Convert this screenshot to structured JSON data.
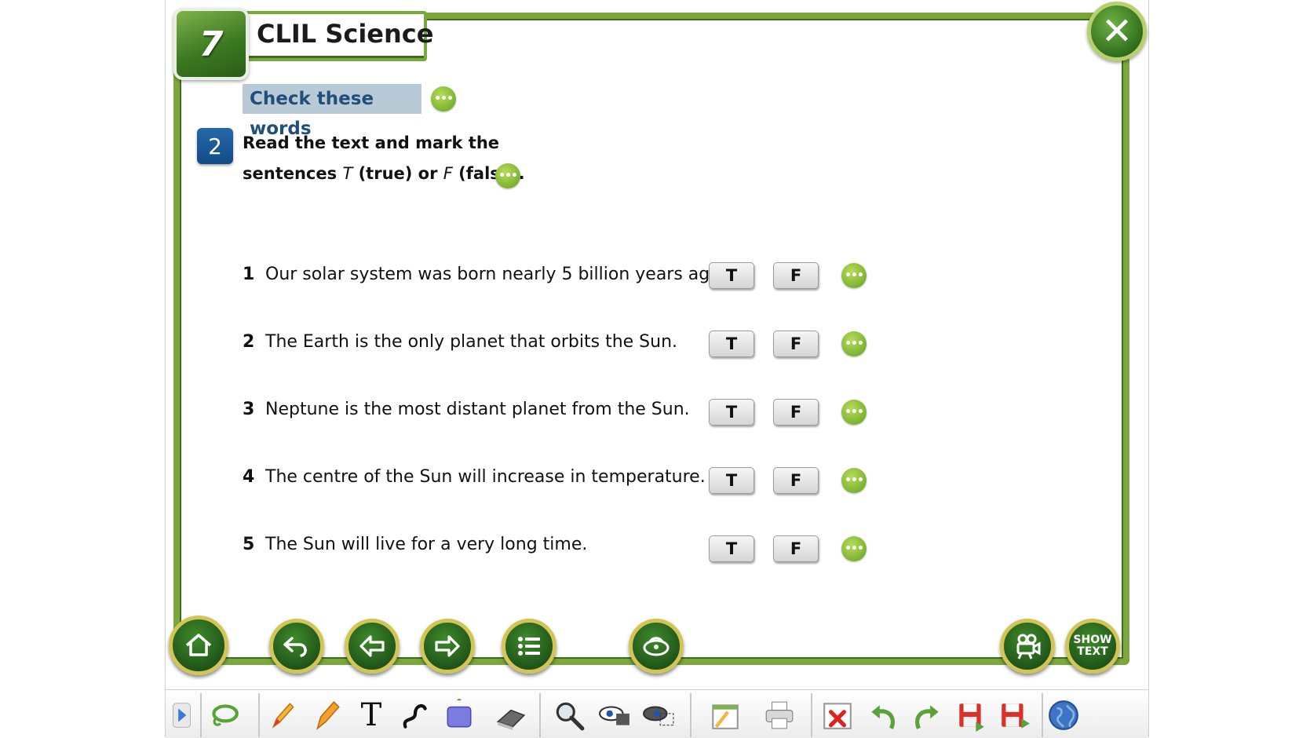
{
  "header": {
    "unit_number": "7",
    "section_title": "CLIL Science"
  },
  "check_words": {
    "label": "Check these words"
  },
  "exercise": {
    "number": "2",
    "instruction_line1": "Read the text and mark the",
    "instruction_line2_a": "sentences ",
    "instruction_T": "T",
    "instruction_line2_b": " (true) or ",
    "instruction_F": "F",
    "instruction_line2_c": " (false)."
  },
  "questions": [
    {
      "num": "1",
      "text": "Our solar system was born nearly 5 billion years ago.",
      "true_label": "T",
      "false_label": "F"
    },
    {
      "num": "2",
      "text": "The Earth is the only planet that orbits the Sun.",
      "true_label": "T",
      "false_label": "F"
    },
    {
      "num": "3",
      "text": "Neptune is the most distant planet from the Sun.",
      "true_label": "T",
      "false_label": "F"
    },
    {
      "num": "4",
      "text": "The centre of the Sun will increase in temperature.",
      "true_label": "T",
      "false_label": "F"
    },
    {
      "num": "5",
      "text": "The Sun will live for a very long time.",
      "true_label": "T",
      "false_label": "F"
    }
  ],
  "dots_label": "•••",
  "close_label": "✕",
  "nav": {
    "show_text_line1": "SHOW",
    "show_text_line2": "TEXT"
  },
  "toolbar_icons": [
    "expand-arrow-icon",
    "lasso-icon",
    "pencil-icon",
    "highlighter-icon",
    "text-tool-icon",
    "line-tool-icon",
    "shape-tool-icon",
    "eraser-icon",
    "magnifier-icon",
    "reveal-tool-icon",
    "spotlight-tool-icon",
    "notepad-icon",
    "printer-icon",
    "clear-all-icon",
    "undo-icon",
    "redo-icon",
    "save-icon",
    "save-as-icon",
    "globe-icon"
  ],
  "text_tool_glyph": "T"
}
